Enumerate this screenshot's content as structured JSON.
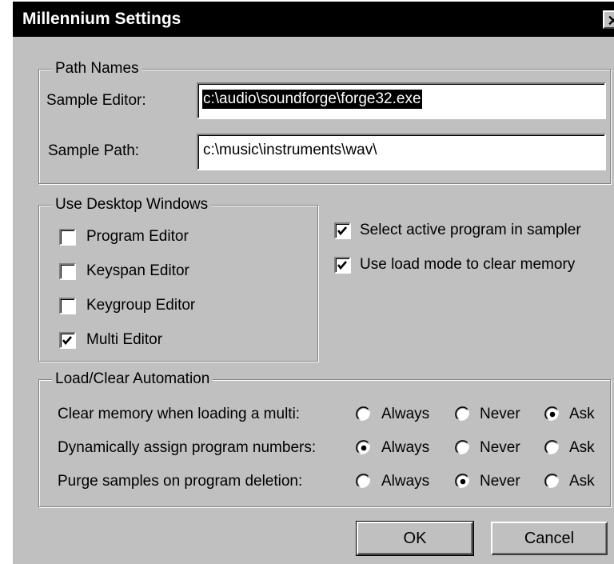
{
  "window": {
    "title": "Millennium Settings",
    "close_glyph": "✕"
  },
  "path_names": {
    "legend": "Path Names",
    "sample_editor_label": "Sample Editor:",
    "sample_editor_value": "c:\\audio\\soundforge\\forge32.exe",
    "sample_path_label": "Sample Path:",
    "sample_path_value": "c:\\music\\instruments\\wav\\"
  },
  "desktop_windows": {
    "legend": "Use Desktop Windows",
    "items": [
      {
        "label": "Program Editor",
        "checked": false
      },
      {
        "label": "Keyspan Editor",
        "checked": false
      },
      {
        "label": "Keygroup Editor",
        "checked": false
      },
      {
        "label": "Multi Editor",
        "checked": true
      }
    ]
  },
  "options": [
    {
      "label": "Select active program in sampler",
      "checked": true
    },
    {
      "label": "Use load mode to clear memory",
      "checked": true
    }
  ],
  "automation": {
    "legend": "Load/Clear Automation",
    "choices": [
      "Always",
      "Never",
      "Ask"
    ],
    "rows": [
      {
        "label": "Clear memory when loading a multi:",
        "selected": "Ask"
      },
      {
        "label": "Dynamically assign program numbers:",
        "selected": "Always"
      },
      {
        "label": "Purge samples on program deletion:",
        "selected": "Never"
      }
    ]
  },
  "buttons": {
    "ok": "OK",
    "cancel": "Cancel"
  }
}
